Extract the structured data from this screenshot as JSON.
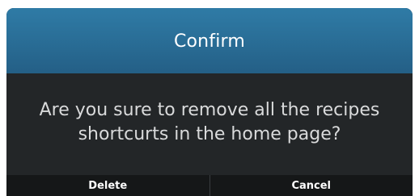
{
  "dialog": {
    "title": "Confirm",
    "message": "Are you sure to remove all the recipes shortcurts in the home page?",
    "buttons": {
      "delete_label": "Delete",
      "cancel_label": "Cancel"
    }
  },
  "colors": {
    "header": "#2a6f98",
    "body": "#232628",
    "footer": "#151718",
    "title_text": "#ffffff",
    "message_text": "#d9dadb"
  }
}
